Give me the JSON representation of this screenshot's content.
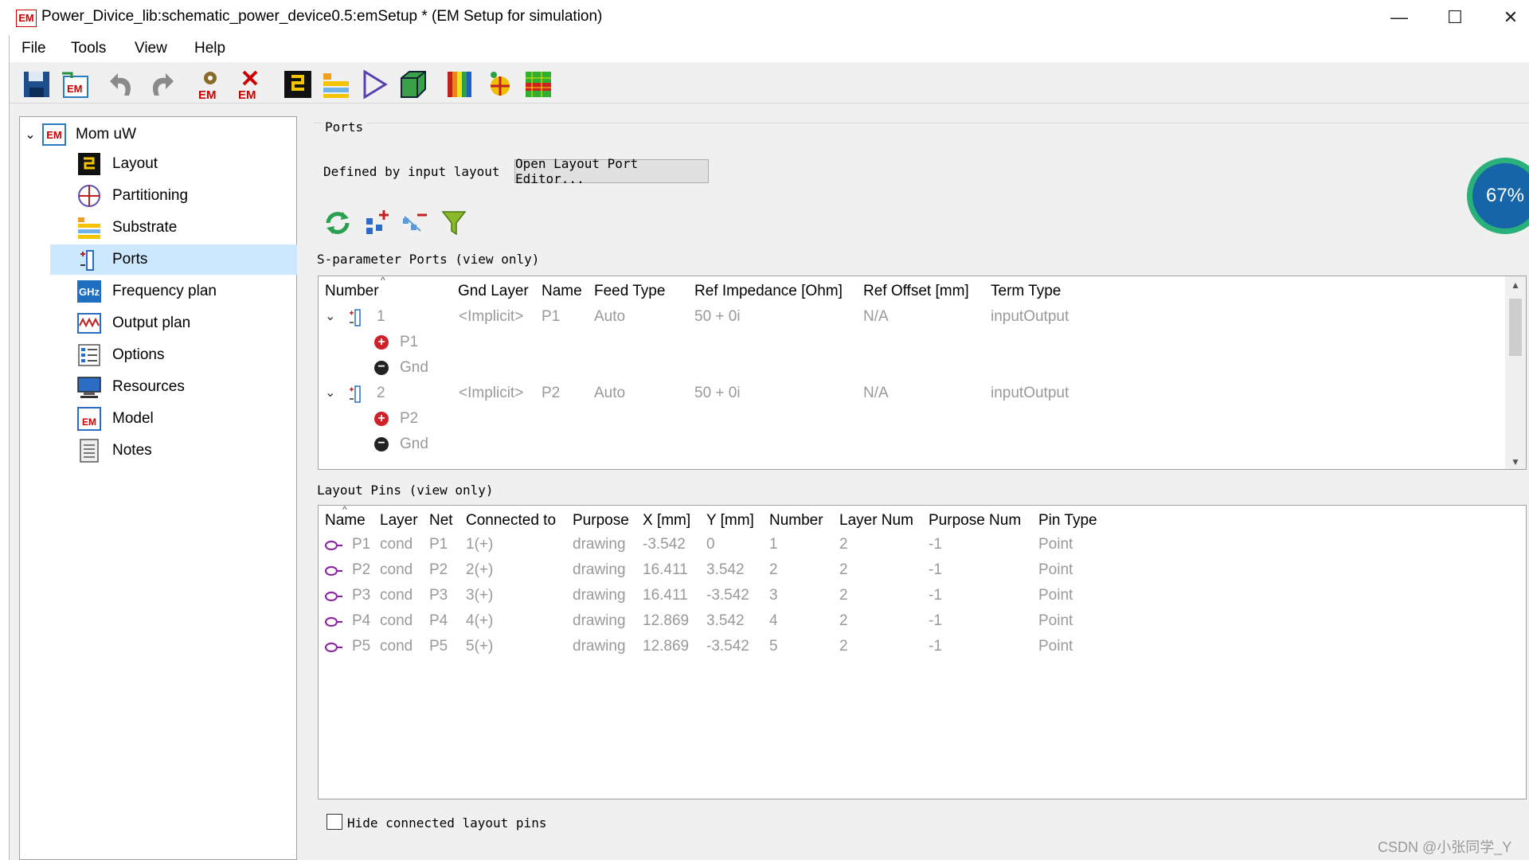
{
  "window": {
    "app_icon": "EM",
    "title": "Power_Divice_lib:schematic_power_device0.5:emSetup * (EM Setup for simulation)",
    "minimize": "—",
    "maximize": "☐",
    "close": "✕"
  },
  "menu": [
    "File",
    "Tools",
    "View",
    "Help"
  ],
  "toolbar": {
    "icons": [
      "save-icon",
      "em-import-icon",
      "undo-icon",
      "redo-icon",
      "em-settings-icon",
      "em-stop-icon",
      "layout-icon",
      "substrate-icon",
      "simulate-icon",
      "3d-view-icon",
      "color-bars-icon",
      "partition-icon",
      "mesh-icon"
    ],
    "em_label": "EM"
  },
  "tree": {
    "root": {
      "label": "Mom uW",
      "icon": "em-icon",
      "icon_text": "EM"
    },
    "items": [
      {
        "label": "Layout",
        "icon": "layout-icon"
      },
      {
        "label": "Partitioning",
        "icon": "partitioning-icon"
      },
      {
        "label": "Substrate",
        "icon": "substrate-icon"
      },
      {
        "label": "Ports",
        "icon": "ports-icon",
        "selected": true
      },
      {
        "label": "Frequency plan",
        "icon": "frequency-icon",
        "icon_text": "GHz"
      },
      {
        "label": "Output plan",
        "icon": "output-plan-icon"
      },
      {
        "label": "Options",
        "icon": "options-icon"
      },
      {
        "label": "Resources",
        "icon": "resources-icon"
      },
      {
        "label": "Model",
        "icon": "model-icon",
        "icon_text": "EM"
      },
      {
        "label": "Notes",
        "icon": "notes-icon"
      }
    ]
  },
  "ports": {
    "group_title": "Ports",
    "defined_label": "Defined by input layout",
    "open_editor_button": "Open Layout Port Editor...",
    "tool_icons": [
      "refresh-icon",
      "add-port-icon",
      "remove-port-icon",
      "filter-icon"
    ],
    "sparam_title": "S-parameter Ports (view only)",
    "sparam_columns": [
      "Number",
      "Gnd Layer",
      "Name",
      "Feed Type",
      "Ref Impedance [Ohm]",
      "Ref Offset [mm]",
      "Term Type"
    ],
    "sparam_rows": [
      {
        "number": "1",
        "gnd_layer": "<Implicit>",
        "name": "P1",
        "feed": "Auto",
        "impedance": "50 + 0i",
        "offset": "N/A",
        "term": "inputOutput",
        "plus": "P1",
        "minus": "Gnd"
      },
      {
        "number": "2",
        "gnd_layer": "<Implicit>",
        "name": "P2",
        "feed": "Auto",
        "impedance": "50 + 0i",
        "offset": "N/A",
        "term": "inputOutput",
        "plus": "P2",
        "minus": "Gnd"
      }
    ],
    "pins_title": "Layout Pins (view only)",
    "pins_columns": [
      "Name",
      "Layer",
      "Net",
      "Connected to",
      "Purpose",
      "X [mm]",
      "Y [mm]",
      "Number",
      "Layer Num",
      "Purpose Num",
      "Pin Type"
    ],
    "pins_rows": [
      [
        "P1",
        "cond",
        "P1",
        "1(+)",
        "drawing",
        "-3.542",
        "0",
        "1",
        "2",
        "-1",
        "Point"
      ],
      [
        "P2",
        "cond",
        "P2",
        "2(+)",
        "drawing",
        "16.411",
        "3.542",
        "2",
        "2",
        "-1",
        "Point"
      ],
      [
        "P3",
        "cond",
        "P3",
        "3(+)",
        "drawing",
        "16.411",
        "-3.542",
        "3",
        "2",
        "-1",
        "Point"
      ],
      [
        "P4",
        "cond",
        "P4",
        "4(+)",
        "drawing",
        "12.869",
        "3.542",
        "4",
        "2",
        "-1",
        "Point"
      ],
      [
        "P5",
        "cond",
        "P5",
        "5(+)",
        "drawing",
        "12.869",
        "-3.542",
        "5",
        "2",
        "-1",
        "Point"
      ]
    ],
    "hide_pins_label": "Hide connected layout pins",
    "hide_pins_checked": false
  },
  "overlay": {
    "gauge_value": "67%"
  },
  "watermark": "CSDN @小张同学_Y"
}
